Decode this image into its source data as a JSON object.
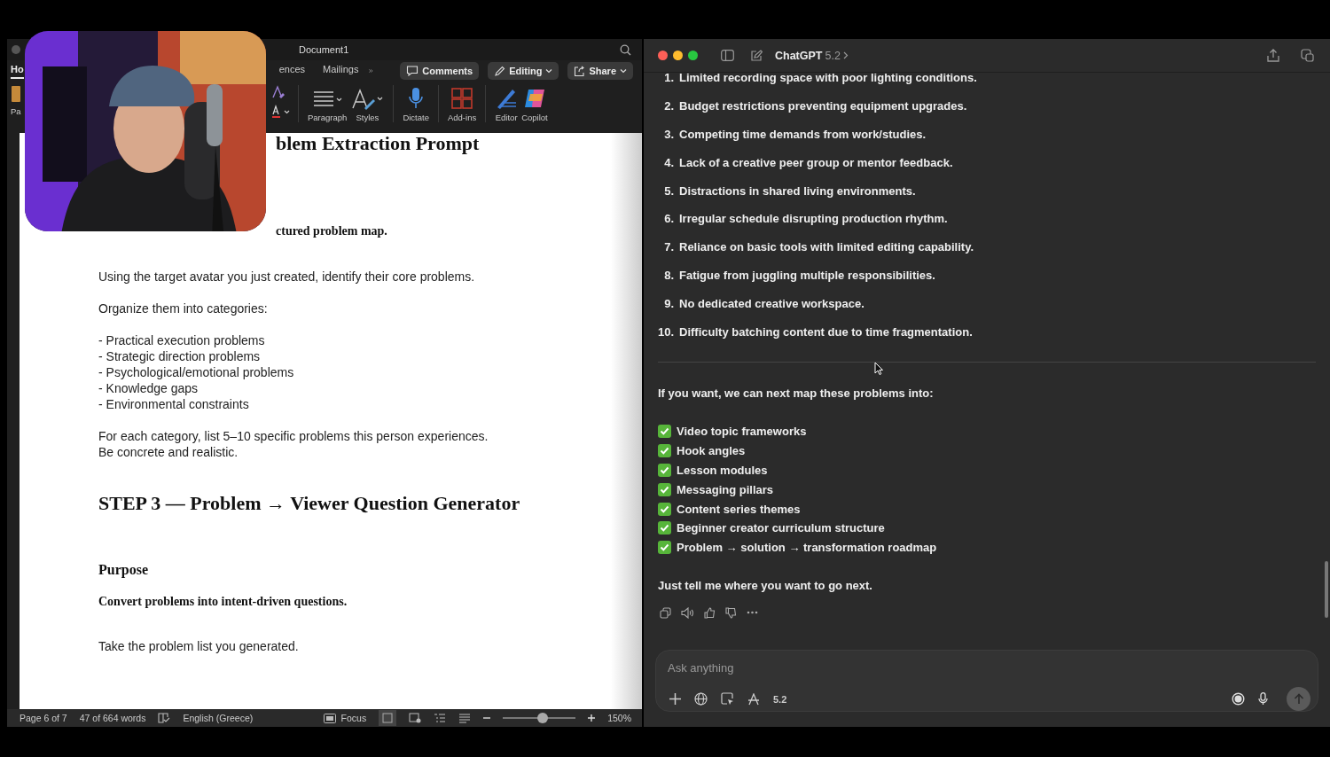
{
  "word": {
    "title": "Document1",
    "tabs": [
      {
        "label": "Ho",
        "selected": true
      },
      {
        "label": "ences",
        "selected": false
      },
      {
        "label": "Mailings",
        "selected": false
      }
    ],
    "buttons": [
      {
        "kind": "comments",
        "label": "Comments"
      },
      {
        "kind": "editing",
        "label": "Editing"
      },
      {
        "kind": "share",
        "label": "Share"
      }
    ],
    "paste": {
      "label": "Pa"
    },
    "ribbon": [
      {
        "kind": "paragraph",
        "label": "Paragraph"
      },
      {
        "kind": "styles",
        "label": "Styles"
      },
      {
        "kind": "dictate",
        "label": "Dictate"
      },
      {
        "kind": "addins",
        "label": "Add-ins"
      },
      {
        "kind": "editor",
        "label": "Editor"
      },
      {
        "kind": "copilot",
        "label": "Copilot"
      }
    ],
    "document": [
      {
        "kind": "title-cut",
        "text": "blem Extraction Prompt"
      },
      {
        "kind": "bold-cut",
        "text": "ctured problem map."
      },
      {
        "kind": "para",
        "text": "Using the target avatar you just created, identify their core problems."
      },
      {
        "kind": "para",
        "text": "Organize them into categories:"
      },
      {
        "kind": "para",
        "text": "- Practical execution problems"
      },
      {
        "kind": "line",
        "text": "- Strategic direction problems"
      },
      {
        "kind": "line",
        "text": "- Psychological/emotional problems"
      },
      {
        "kind": "line",
        "text": "- Knowledge gaps"
      },
      {
        "kind": "line",
        "text": "- Environmental constraints"
      },
      {
        "kind": "para",
        "text": "For each category, list 5–10 specific problems this person experiences."
      },
      {
        "kind": "line",
        "text": "Be concrete and realistic."
      },
      {
        "kind": "h1",
        "text": "STEP 3 — Problem → Viewer Question Generator"
      },
      {
        "kind": "h2",
        "text": "Purpose"
      },
      {
        "kind": "bold",
        "text": "Convert problems into intent-driven questions."
      },
      {
        "kind": "para",
        "text": "Take the problem list you generated."
      }
    ],
    "status": {
      "page": "Page 6 of 7",
      "words": "47 of 664 words",
      "language": "English (Greece)",
      "focus": "Focus",
      "zoom": {
        "level": 0.55
      },
      "zoom_label": "150%"
    }
  },
  "chat": {
    "title": "ChatGPT",
    "model": "5.2",
    "items": [
      {
        "number": "1.",
        "text": "Limited recording space with poor lighting conditions."
      },
      {
        "number": "2.",
        "text": "Budget restrictions preventing equipment upgrades."
      },
      {
        "number": "3.",
        "text": "Competing time demands from work/studies."
      },
      {
        "number": "4.",
        "text": "Lack of a creative peer group or mentor feedback."
      },
      {
        "number": "5.",
        "text": "Distractions in shared living environments."
      },
      {
        "number": "6.",
        "text": "Irregular schedule disrupting production rhythm."
      },
      {
        "number": "7.",
        "text": "Reliance on basic tools with limited editing capability."
      },
      {
        "number": "8.",
        "text": "Fatigue from juggling multiple responsibilities."
      },
      {
        "number": "9.",
        "text": "No dedicated creative workspace."
      },
      {
        "number": "10.",
        "text": "Difficulty batching content due to time fragmentation."
      }
    ],
    "intro": "If you want, we can next map these problems into:",
    "options": [
      "Video topic frameworks",
      "Hook angles",
      "Lesson modules",
      "Messaging pillars",
      "Content series themes",
      "Beginner creator curriculum structure",
      "Problem → solution → transformation roadmap"
    ],
    "closing": "Just tell me where you want to go next.",
    "input": {
      "placeholder": "Ask anything"
    },
    "model_chip": "5.2"
  }
}
